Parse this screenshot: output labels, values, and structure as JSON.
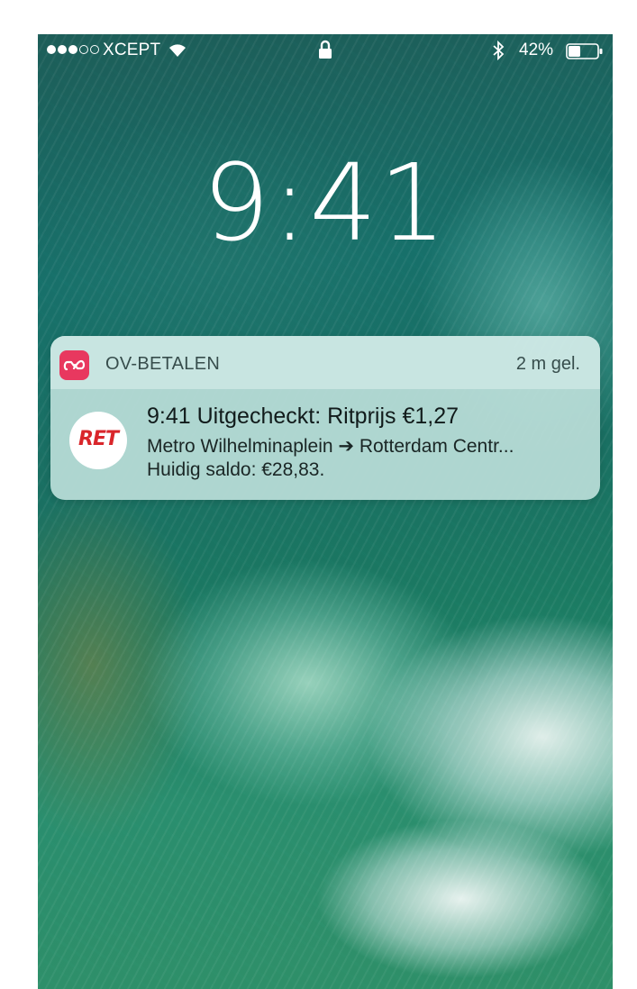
{
  "status_bar": {
    "signal_bars_filled": 3,
    "signal_bars_total": 5,
    "carrier": "XCEPT",
    "battery_percent": "42%",
    "battery_level": 0.42,
    "icons": [
      "wifi-icon",
      "lock-icon",
      "bluetooth-icon",
      "battery-icon"
    ]
  },
  "lock_screen": {
    "time": "9:41"
  },
  "notification": {
    "app_name": "OV-BETALEN",
    "time_ago": "2 m gel.",
    "app_icon": "ov-betalen-app-icon",
    "app_icon_color": "#e8385f",
    "sender_logo_text": "RET",
    "sender_logo_color": "#d9262b",
    "title": "9:41 Uitgecheckt: Ritprijs €1,27",
    "body_line1": "Metro Wilhelminaplein ➔ Rotterdam Centr...",
    "body_line2": "Huidig saldo: €28,83."
  }
}
